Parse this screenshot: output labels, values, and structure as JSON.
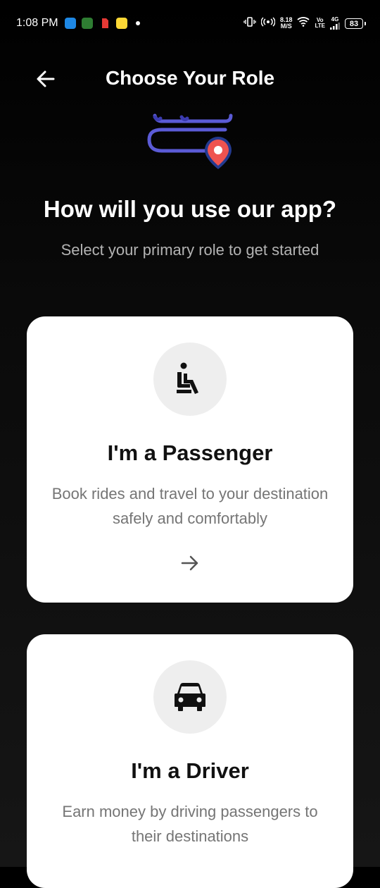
{
  "status_bar": {
    "time": "1:08 PM",
    "net_speed_value": "8.18",
    "net_speed_unit": "M/S",
    "vo_lte_top": "Vo",
    "vo_lte_bottom": "LTE",
    "network_type": "4G",
    "battery": "83"
  },
  "header": {
    "title": "Choose Your Role",
    "back_icon": "arrow-left-icon"
  },
  "intro": {
    "headline": "How will you use our app?",
    "subtitle": "Select your primary role to get started"
  },
  "roles": [
    {
      "title": "I'm a Passenger",
      "description": "Book rides and travel to your destination safely and comfortably",
      "icon": "seated-passenger-icon"
    },
    {
      "title": "I'm a Driver",
      "description": "Earn money by driving passengers to their destinations",
      "icon": "car-icon"
    }
  ],
  "colors": {
    "accent_route": "#5b5bd6",
    "pin": "#ef5350",
    "card_bg": "#ffffff",
    "icon_circle": "#eeeeee"
  }
}
